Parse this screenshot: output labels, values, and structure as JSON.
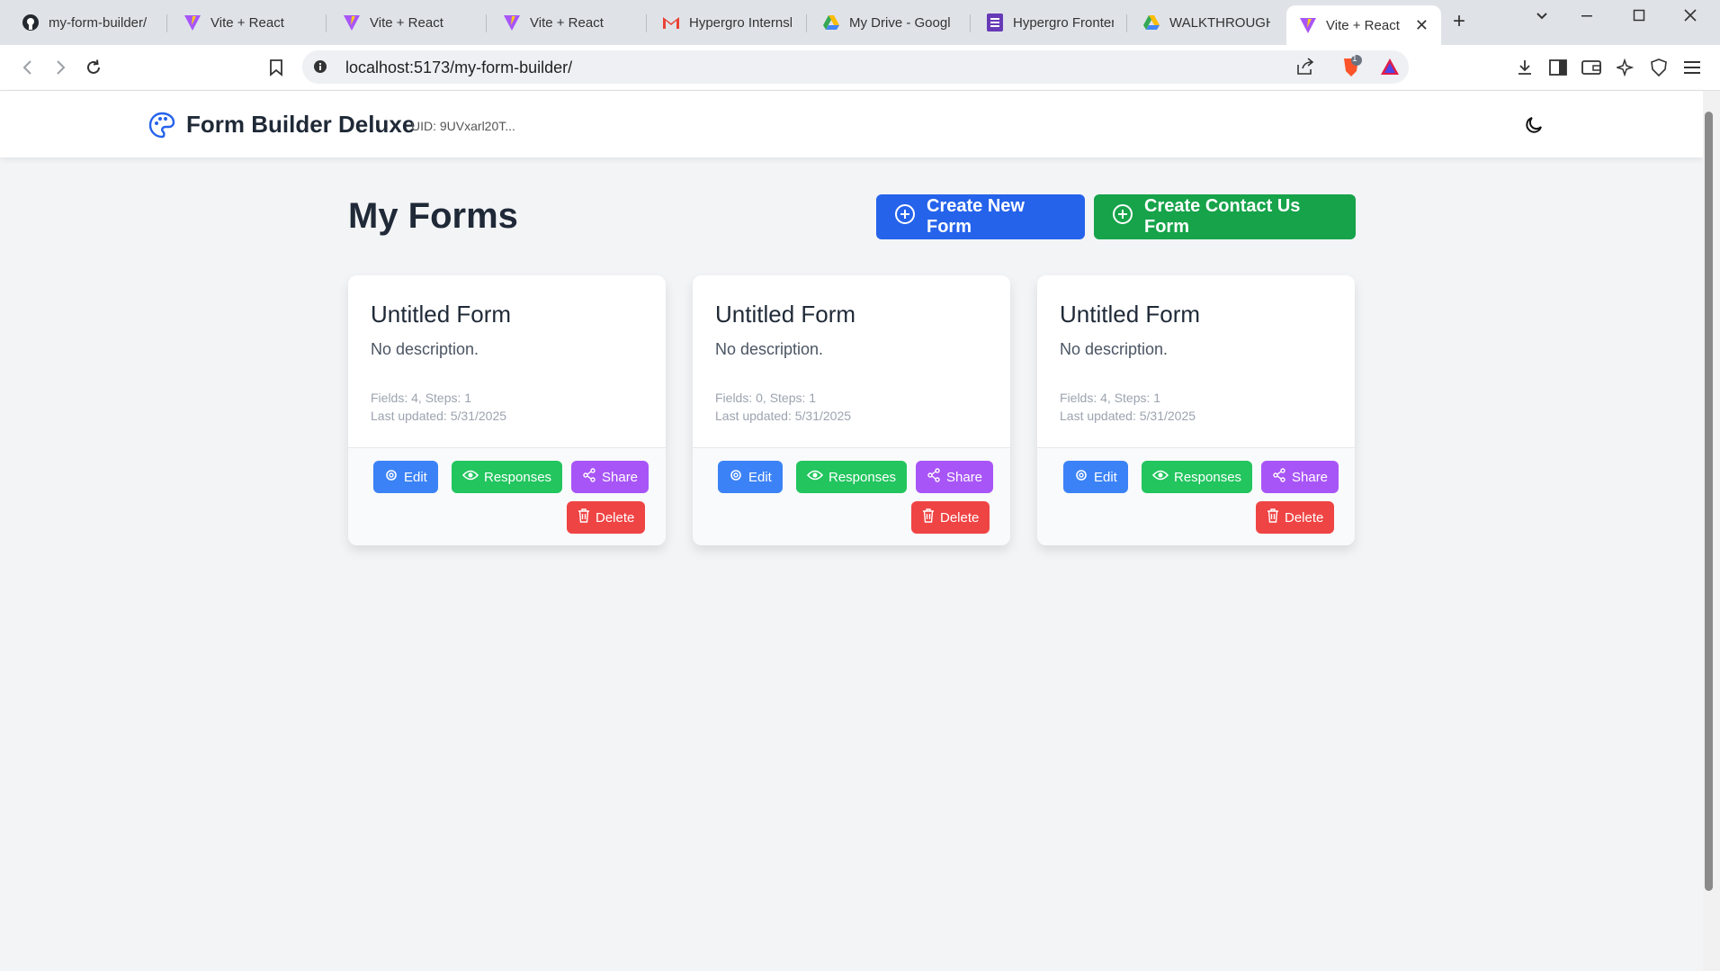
{
  "browser": {
    "tabs": [
      {
        "title": "my-form-builder/",
        "icon": "github-icon"
      },
      {
        "title": "Vite + React",
        "icon": "vite-icon"
      },
      {
        "title": "Vite + React",
        "icon": "vite-icon"
      },
      {
        "title": "Vite + React",
        "icon": "vite-icon"
      },
      {
        "title": "Hypergro Internsl",
        "icon": "gmail-icon"
      },
      {
        "title": "My Drive - Googl",
        "icon": "drive-icon"
      },
      {
        "title": "Hypergro Fronter",
        "icon": "forms-icon"
      },
      {
        "title": "WALKTHROUGH",
        "icon": "drive-icon"
      },
      {
        "title": "Vite + React",
        "icon": "vite-icon",
        "active": true
      }
    ],
    "url": "localhost:5173/my-form-builder/",
    "brave_badge": "1"
  },
  "header": {
    "title": "Form Builder Deluxe",
    "uid": "UID: 9UVxarl20T..."
  },
  "main": {
    "title": "My Forms",
    "create_new_label": "Create New Form",
    "create_contact_label": "Create Contact Us Form"
  },
  "forms": [
    {
      "title": "Untitled Form",
      "description": "No description.",
      "stats": "Fields: 4, Steps: 1",
      "updated": "Last updated: 5/31/2025"
    },
    {
      "title": "Untitled Form",
      "description": "No description.",
      "stats": "Fields: 0, Steps: 1",
      "updated": "Last updated: 5/31/2025"
    },
    {
      "title": "Untitled Form",
      "description": "No description.",
      "stats": "Fields: 4, Steps: 1",
      "updated": "Last updated: 5/31/2025"
    }
  ],
  "card_actions": {
    "edit": "Edit",
    "responses": "Responses",
    "share": "Share",
    "delete": "Delete"
  },
  "colors": {
    "primary_blue": "#2563eb",
    "primary_green": "#16a34a",
    "edit": "#3b82f6",
    "responses": "#22c55e",
    "share": "#a855f7",
    "delete": "#ef4444"
  }
}
